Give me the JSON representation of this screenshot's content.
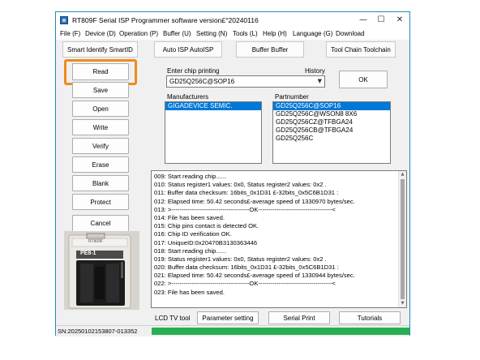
{
  "window": {
    "title": "RT809F Serial ISP Programmer software version£°20240116",
    "minimize": "—",
    "maximize": "☐",
    "close": "✕"
  },
  "menu": [
    "File (F)",
    "Device (D)",
    "Operation (P)",
    "Buffer (U)",
    "Setting (N)",
    "Tools (L)",
    "Help (H)",
    "Language (G)",
    "Download"
  ],
  "top_buttons": [
    "Smart Identify SmartID",
    "Auto ISP AutoISP",
    "Buffer Buffer",
    "Tool Chain Toolchain"
  ],
  "side_buttons": [
    "Read",
    "Save",
    "Open",
    "Write",
    "Verify",
    "Erase",
    "Blank",
    "Protect",
    "Cancel"
  ],
  "chip": {
    "enter_label": "Enter chip printing",
    "history_label": "History",
    "value": "GD25Q256C@SOP16",
    "ok": "OK"
  },
  "manufacturers": {
    "label": "Manufacturers",
    "items": [
      "GIGADEVICE SEMIC."
    ],
    "selected": 0
  },
  "partnumber": {
    "label": "Partnumber",
    "items": [
      "GD25Q256C@SOP16",
      "GD25Q256C@WSON8 8X6",
      "GD25Q256CZ@TFBGA24",
      "GD25Q256CB@TFBGA24",
      "GD25Q256C"
    ],
    "selected": 0
  },
  "log": [
    "009:  Start reading chip......",
    "010:  Status register1 values: 0x0, Status register2 values: 0x2 .",
    "011:  Buffer data checksum: 16bits_0x1D31 £-32bits_0x5C6B1D31 :",
    "012:  Elapsed time: 50.42 seconds£-average speed of 1330970 bytes/sec.",
    "013:  >--------------------------------------OK------------------------------------<",
    "014:  File has been saved.",
    "015:  Chip pins contact is detected OK.",
    "016:  Chip ID verification OK.",
    "017:  UniqueID:0x20470B3130363446",
    "018:  Start reading chip......",
    "019:  Status register1 values: 0x0, Status register2 values: 0x2 .",
    "020:  Buffer data checksum: 16bits_0x1D31 £-32bits_0x5C6B1D31 :",
    "021:  Elapsed time: 50.42 seconds£-average speed of 1330944 bytes/sec.",
    "022:  >--------------------------------------OK------------------------------------<",
    "023:  File has been saved."
  ],
  "bottom": {
    "lcd_label": "LCD TV tool",
    "buttons": [
      "Parameter setting",
      "Serial Print",
      "Tutorials"
    ]
  },
  "photo": {
    "board_label": "PE8-1",
    "brand": "RT809F"
  },
  "status": {
    "sn": "SN:20250102153807-013352",
    "progress_percent": 100,
    "progress_color": "#26b050"
  },
  "colors": {
    "selection": "#0078d7",
    "highlight": "#ee8a1f",
    "window_border": "#1e8cb9"
  }
}
